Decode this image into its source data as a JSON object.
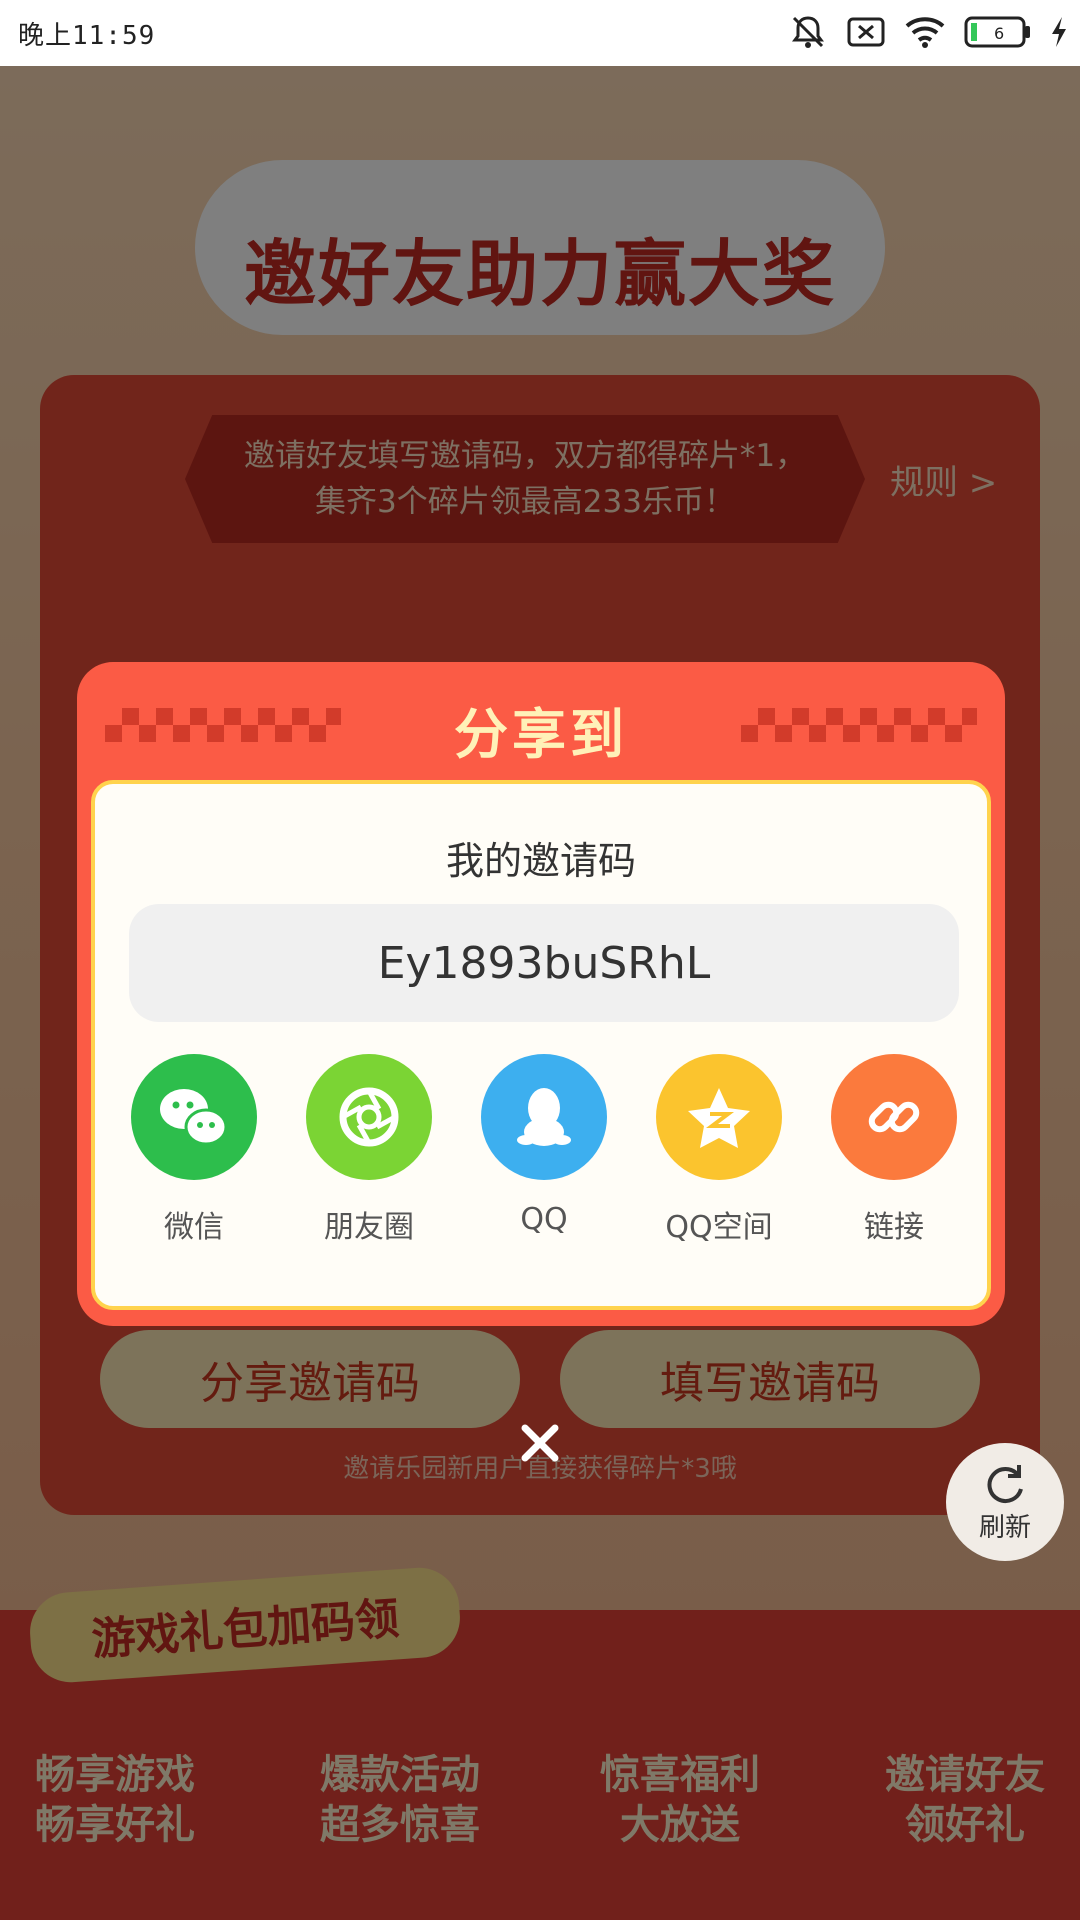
{
  "status_bar": {
    "time": "晚上11:59",
    "time_ruby": "wǎn shàng",
    "battery_level": "6"
  },
  "page": {
    "title": "邀好友助力赢大奖",
    "rule_text": "邀请好友填写邀请码，双方都得碎片*1，集齐3个碎片领最高233乐币！",
    "rule_link": "规则 >",
    "share_code_button": "分享邀请码",
    "fill_code_button": "填写邀请码",
    "tip": "邀请乐园新用户直接获得碎片*3哦",
    "refresh_label": "刷新",
    "gift_tag": "游戏礼包加码领",
    "promos": [
      {
        "line1": "畅享游戏",
        "line2": "畅享好礼"
      },
      {
        "line1": "爆款活动",
        "line2": "超多惊喜"
      },
      {
        "line1": "惊喜福利",
        "line2": "大放送"
      },
      {
        "line1": "邀请好友",
        "line2": "领好礼"
      }
    ]
  },
  "modal": {
    "title": "分享到",
    "code_label": "我的邀请码",
    "invite_code": "Ey1893buSRhL",
    "share_targets": [
      {
        "label": "微信",
        "icon": "wechat-icon",
        "color": "#2dbe4c"
      },
      {
        "label": "朋友圈",
        "icon": "moments-icon",
        "color": "#7bd434"
      },
      {
        "label": "QQ",
        "icon": "qq-icon",
        "color": "#3dafef"
      },
      {
        "label": "QQ空间",
        "icon": "qzone-icon",
        "color": "#fbc42e"
      },
      {
        "label": "链接",
        "icon": "link-icon",
        "color": "#fb7a3d"
      }
    ]
  },
  "colors": {
    "modal_bg": "#fb5b45",
    "accent_yellow": "#ffd34d"
  }
}
